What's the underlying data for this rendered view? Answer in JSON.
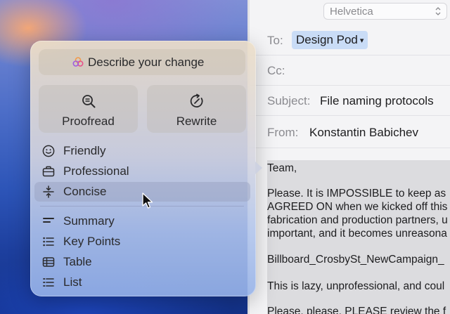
{
  "mail": {
    "font_selector": {
      "value": "Helvetica"
    },
    "to": {
      "label": "To:",
      "recipient": "Design Pod"
    },
    "cc": {
      "label": "Cc:"
    },
    "subject": {
      "label": "Subject:",
      "value": "File naming protocols"
    },
    "from": {
      "label": "From:",
      "value": "Konstantin Babichev"
    },
    "body_lines": [
      "Team,",
      "Please. It is IMPOSSIBLE to keep as",
      "AGREED ON when we kicked off this",
      "fabrication and production partners, u",
      "important, and it becomes unreasona",
      "Billboard_CrosbySt_NewCampaign_",
      "This is lazy, unprofessional, and coul",
      "Please, please, PLEASE review the f"
    ]
  },
  "writing_tools": {
    "describe_label": "Describe your change",
    "proofread_label": "Proofread",
    "rewrite_label": "Rewrite",
    "tone_items": [
      {
        "label": "Friendly",
        "icon": "smiley-icon"
      },
      {
        "label": "Professional",
        "icon": "briefcase-icon"
      },
      {
        "label": "Concise",
        "icon": "compress-icon"
      }
    ],
    "format_items": [
      {
        "label": "Summary",
        "icon": "summary-icon"
      },
      {
        "label": "Key Points",
        "icon": "bullet-list-icon"
      },
      {
        "label": "Table",
        "icon": "table-icon"
      },
      {
        "label": "List",
        "icon": "list-icon"
      }
    ],
    "selected_item": "Concise"
  }
}
